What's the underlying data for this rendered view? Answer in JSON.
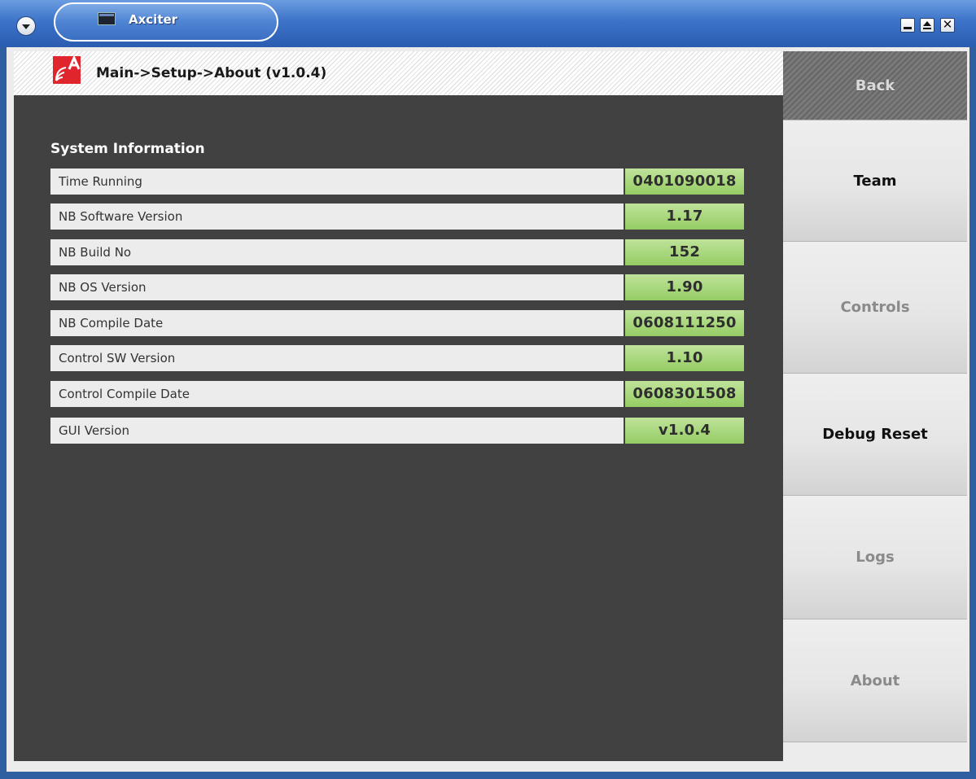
{
  "window": {
    "title": "Axciter"
  },
  "header": {
    "breadcrumb": "Main->Setup->About (v1.0.4)"
  },
  "system_info": {
    "title": "System Information",
    "rows": [
      {
        "label": "Time Running",
        "value": "0401090018"
      },
      {
        "label": "NB Software Version",
        "value": "1.17"
      },
      {
        "label": "NB Build No",
        "value": "152"
      },
      {
        "label": "NB OS Version",
        "value": "1.90"
      },
      {
        "label": "NB Compile Date",
        "value": "0608111250"
      },
      {
        "label": "Control SW Version",
        "value": "1.10"
      },
      {
        "label": "Control Compile Date",
        "value": "0608301508"
      },
      {
        "label": "GUI Version",
        "value": "v1.0.4"
      }
    ]
  },
  "nav": {
    "items": [
      {
        "label": "Back"
      },
      {
        "label": "Team"
      },
      {
        "label": "Controls"
      },
      {
        "label": "Debug Reset"
      },
      {
        "label": "Logs"
      },
      {
        "label": "About"
      }
    ]
  },
  "colors": {
    "value_green": "#a9d67c",
    "content_bg": "#414141",
    "titlebar_blue": "#3c73c8"
  }
}
